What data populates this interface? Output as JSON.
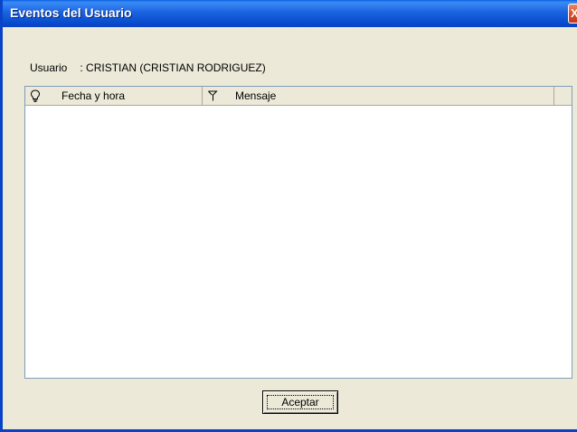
{
  "window": {
    "title": "Eventos del Usuario",
    "close_glyph": "X"
  },
  "user": {
    "label": "Usuario",
    "value": ": CRISTIAN  (CRISTIAN RODRIGUEZ)"
  },
  "table": {
    "columns": [
      {
        "label": "Fecha y hora",
        "icon": "lightbulb-icon"
      },
      {
        "label": "Mensaje",
        "icon": "flag-icon"
      },
      {
        "label": "",
        "icon": ""
      }
    ],
    "rows": []
  },
  "footer": {
    "ok_label": "Aceptar"
  },
  "colors": {
    "titlebar": "#0a4ed0",
    "dialog_bg": "#ece9d8",
    "close_button": "#d9502c"
  }
}
